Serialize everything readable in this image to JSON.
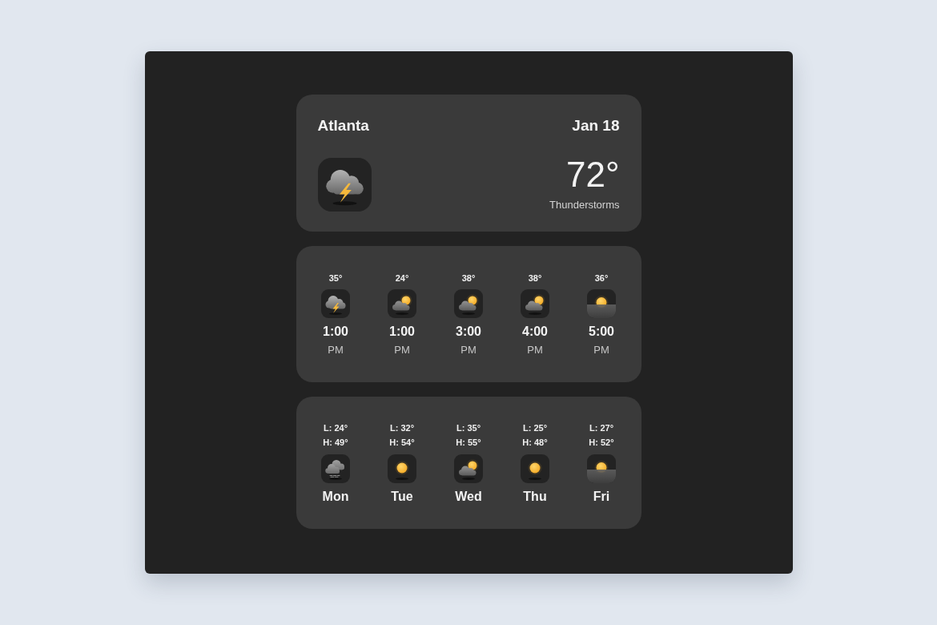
{
  "current": {
    "city": "Atlanta",
    "date": "Jan 18",
    "kind": "thunderstorm",
    "temperature": "72°",
    "description": "Thunderstorms"
  },
  "hourly": [
    {
      "temperature": "35°",
      "kind": "thunderstorm",
      "time": "1:00",
      "period": "PM"
    },
    {
      "temperature": "24°",
      "kind": "partly_cloudy",
      "time": "1:00",
      "period": "PM"
    },
    {
      "temperature": "38°",
      "kind": "partly_cloudy",
      "time": "3:00",
      "period": "PM"
    },
    {
      "temperature": "38°",
      "kind": "partly_cloudy",
      "time": "4:00",
      "period": "PM"
    },
    {
      "temperature": "36°",
      "kind": "haze",
      "time": "5:00",
      "period": "PM"
    }
  ],
  "daily": [
    {
      "low": "L: 24°",
      "high": "H: 49°",
      "kind": "rain",
      "day": "Mon"
    },
    {
      "low": "L: 32°",
      "high": "H: 54°",
      "kind": "sunny",
      "day": "Tue"
    },
    {
      "low": "L: 35°",
      "high": "H: 55°",
      "kind": "partly_cloudy",
      "day": "Wed"
    },
    {
      "low": "L: 25°",
      "high": "H: 48°",
      "kind": "sunny",
      "day": "Thu"
    },
    {
      "low": "L: 27°",
      "high": "H: 52°",
      "kind": "haze",
      "day": "Fri"
    }
  ]
}
